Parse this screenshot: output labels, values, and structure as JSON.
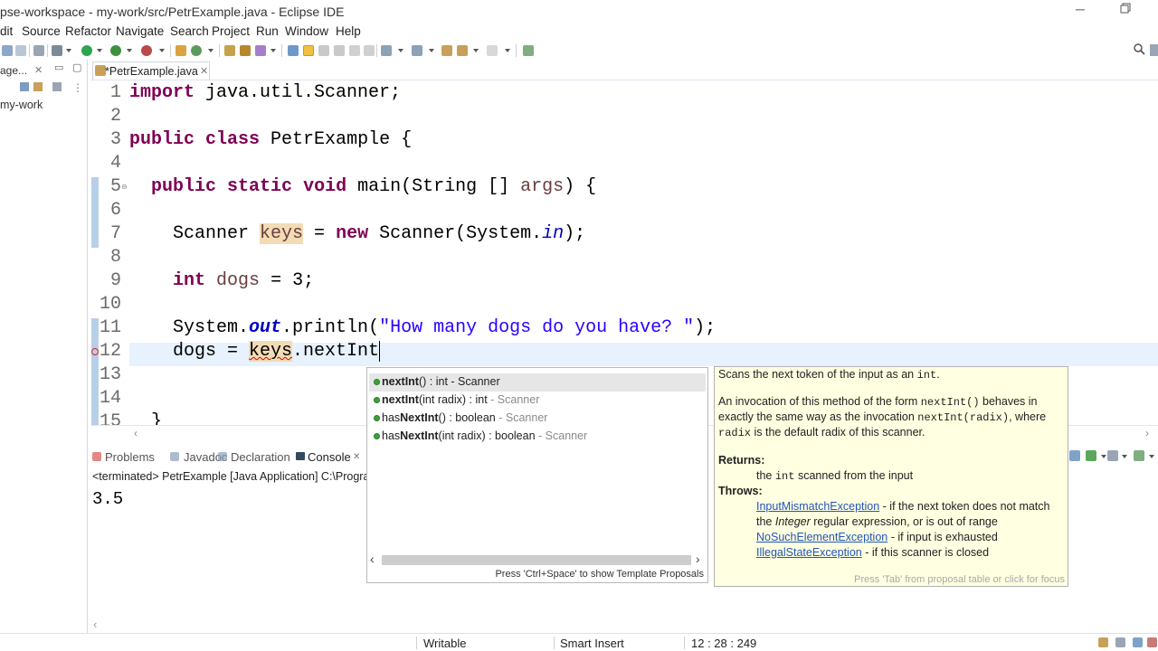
{
  "window": {
    "title": "pse-workspace - my-work/src/PetrExample.java - Eclipse IDE"
  },
  "menu": [
    "dit",
    "Source",
    "Refactor",
    "Navigate",
    "Search",
    "Project",
    "Run",
    "Window",
    "Help"
  ],
  "left_panel": {
    "tab_label": "age...",
    "project": "my-work"
  },
  "editor": {
    "tab_label": "*PetrExample.java",
    "line_numbers": [
      "1",
      "2",
      "3",
      "4",
      "5",
      "6",
      "7",
      "8",
      "9",
      "10",
      "11",
      "12",
      "13",
      "14",
      "15"
    ],
    "line5_fold": "⊖",
    "tokens": {
      "kw_import": "import",
      "import_path": " java.util.Scanner;",
      "kw_public": "public",
      "kw_class": "class",
      "class_decl": " PetrExample {",
      "kw_static": "static",
      "kw_void": "void",
      "main_sig_a": " main(String [] ",
      "main_args": "args",
      "main_sig_b": ") {",
      "scanner_type": "Scanner ",
      "keys_var": "keys",
      "assign": " = ",
      "kw_new": "new",
      "scanner_ctor": " Scanner(System.",
      "field_in": "in",
      "ctor_end": ");",
      "kw_int": "int",
      "dogs_var": "dogs",
      "dogs_init": " = 3;",
      "println_a": "System.",
      "field_out": "out",
      "println_b": ".println(",
      "prompt_str": "\"How many dogs do you have? \"",
      "println_end": ");",
      "dogs_assign": "dogs = ",
      "keys_ref": "keys",
      "next_call": ".nextInt",
      "closing_brace": "}"
    }
  },
  "bottom_panel": {
    "tabs": [
      "Problems",
      "Javadoc",
      "Declaration",
      "Console"
    ],
    "console_header": "<terminated> PetrExample [Java Application] C:\\Progra",
    "console_output": "3.5"
  },
  "completion": {
    "items": [
      {
        "name": "nextInt",
        "sig": "() : int",
        "type": " - Scanner"
      },
      {
        "name": "nextInt",
        "sig": "(int radix) : int",
        "type": " - Scanner"
      },
      {
        "prefix": "has",
        "name": "NextInt",
        "sig": "() : boolean",
        "type": " - Scanner"
      },
      {
        "prefix": "has",
        "name": "NextInt",
        "sig": "(int radix) : boolean",
        "type": " - Scanner"
      }
    ],
    "footer": "Press 'Ctrl+Space' to show Template Proposals"
  },
  "javadoc": {
    "l1a": "Scans the next token of the input as an ",
    "l1b": "int",
    "l1c": ".",
    "l2a": "An invocation of this method of the form ",
    "l2b": "nextInt()",
    "l2c": " behaves in",
    "l3a": "exactly the same way as the invocation ",
    "l3b": "nextInt(radix)",
    "l3c": ", where",
    "l4a": "radix",
    "l4b": " is the default radix of this scanner.",
    "returns_label": "Returns:",
    "returns_a": "the ",
    "returns_b": "int",
    "returns_c": " scanned from the input",
    "throws_label": "Throws:",
    "t1_link": "InputMismatchException",
    "t1_text": " - if the next token does not match",
    "t1b_a": "the ",
    "t1b_b": "Integer",
    "t1b_c": " regular expression, or is out of range",
    "t2_link": "NoSuchElementException",
    "t2_text": " - if input is exhausted",
    "t3_link": "IllegalStateException",
    "t3_text": " - if this scanner is closed",
    "footer": "Press 'Tab' from proposal table or click for focus"
  },
  "status": {
    "writable": "Writable",
    "insert_mode": "Smart Insert",
    "position": "12 : 28 : 249"
  }
}
